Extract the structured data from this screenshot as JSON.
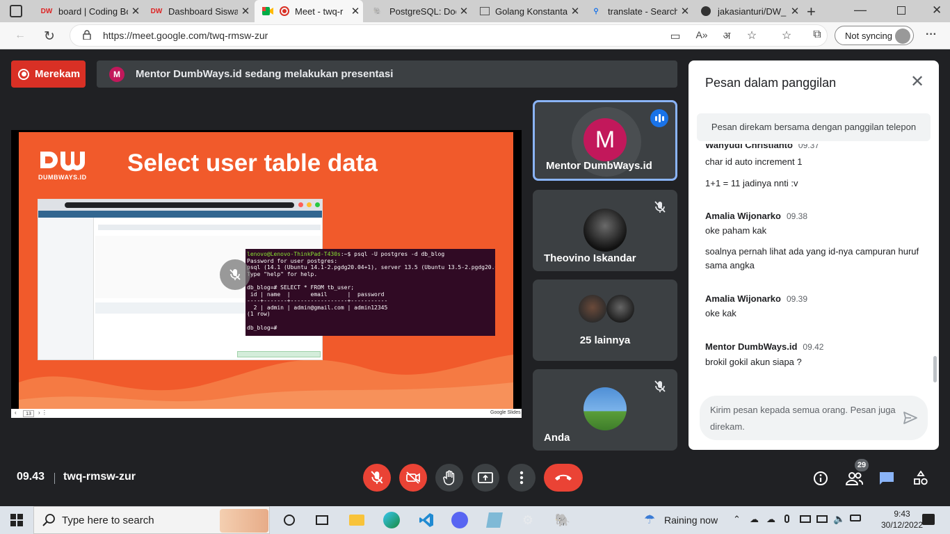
{
  "browser": {
    "tabs": [
      {
        "label": "board | Coding Bo",
        "icon": "dumbways-icon"
      },
      {
        "label": "Dashboard Siswa",
        "icon": "dumbways-icon"
      },
      {
        "label": "Meet - twq-r",
        "icon": "meet-icon",
        "active": true
      },
      {
        "label": "PostgreSQL: Docu",
        "icon": "postgres-icon"
      },
      {
        "label": "Golang Konstanta",
        "icon": "book-icon"
      },
      {
        "label": "translate - Search",
        "icon": "search-icon"
      },
      {
        "label": "jakasianturi/DW_",
        "icon": "github-icon"
      }
    ],
    "url": "https://meet.google.com/twq-rmsw-zur",
    "profile_label": "Not syncing"
  },
  "meet": {
    "recording_label": "Merekam",
    "presenter_initial": "M",
    "presenting_text": "Mentor DumbWays.id sedang melakukan presentasi",
    "slide": {
      "logo_text": "DUMBWAYS.ID",
      "title": "Select user table data",
      "page": "13",
      "brand": "Google Slides",
      "terminal": {
        "prompt": "lenovo@Lenovo-ThinkPad-T430s",
        "line1": ":~$ psql -U postgres -d db_blog",
        "line2": "Password for user postgres:",
        "line3": "psql (14.1 (Ubuntu 14.1-2.pgdg20.04+1), server 13.5 (Ubuntu 13.5-2.pgdg20.04+1))",
        "line4": "Type \"help\" for help.",
        "line5": "",
        "line6": "db_blog=# SELECT * FROM tb_user;",
        "line7": " id | name  |      email      |  password",
        "line8": "----+-------+-----------------+-----------",
        "line9": "  2 | admin | admin@gmail.com | admin12345",
        "line10": "(1 row)",
        "line11": "",
        "line12": "db_blog=# "
      }
    },
    "participants": [
      {
        "name": "Mentor DumbWays.id",
        "initial": "M",
        "speaking": true
      },
      {
        "name": "Theovino Iskandar",
        "muted": true
      },
      {
        "name": "25 lainnya"
      },
      {
        "name": "Anda",
        "muted": true
      }
    ],
    "chat": {
      "title": "Pesan dalam panggilan",
      "info": "Pesan direkam bersama dengan panggilan telepon",
      "messages": [
        {
          "sender": "Wahyudi Christianto",
          "time": "09.37",
          "lines": [
            "char id auto increment 1",
            "1+1 = 11 jadinya nnti :v"
          ]
        },
        {
          "sender": "Amalia Wijonarko",
          "time": "09.38",
          "lines": [
            "oke paham kak",
            "soalnya pernah lihat ada yang id-nya campuran huruf sama angka"
          ]
        },
        {
          "sender": "Amalia Wijonarko",
          "time": "09.39",
          "lines": [
            "oke kak"
          ]
        },
        {
          "sender": "Mentor DumbWays.id",
          "time": "09.42",
          "lines": [
            "brokil gokil akun siapa ?"
          ]
        }
      ],
      "input_placeholder": "Kirim pesan kepada semua orang. Pesan juga direkam."
    },
    "bottom": {
      "time": "09.43",
      "code": "twq-rmsw-zur",
      "people_count": "29"
    }
  },
  "taskbar": {
    "search_placeholder": "Type here to search",
    "weather": "Raining now",
    "time": "9:43",
    "date": "30/12/2022"
  },
  "colors": {
    "recording": "#d93025",
    "end_call": "#ea4335",
    "slide_bg": "#f15a2b",
    "active_speaker": "#8ab4f8",
    "chat_accent": "#1a73e8"
  }
}
